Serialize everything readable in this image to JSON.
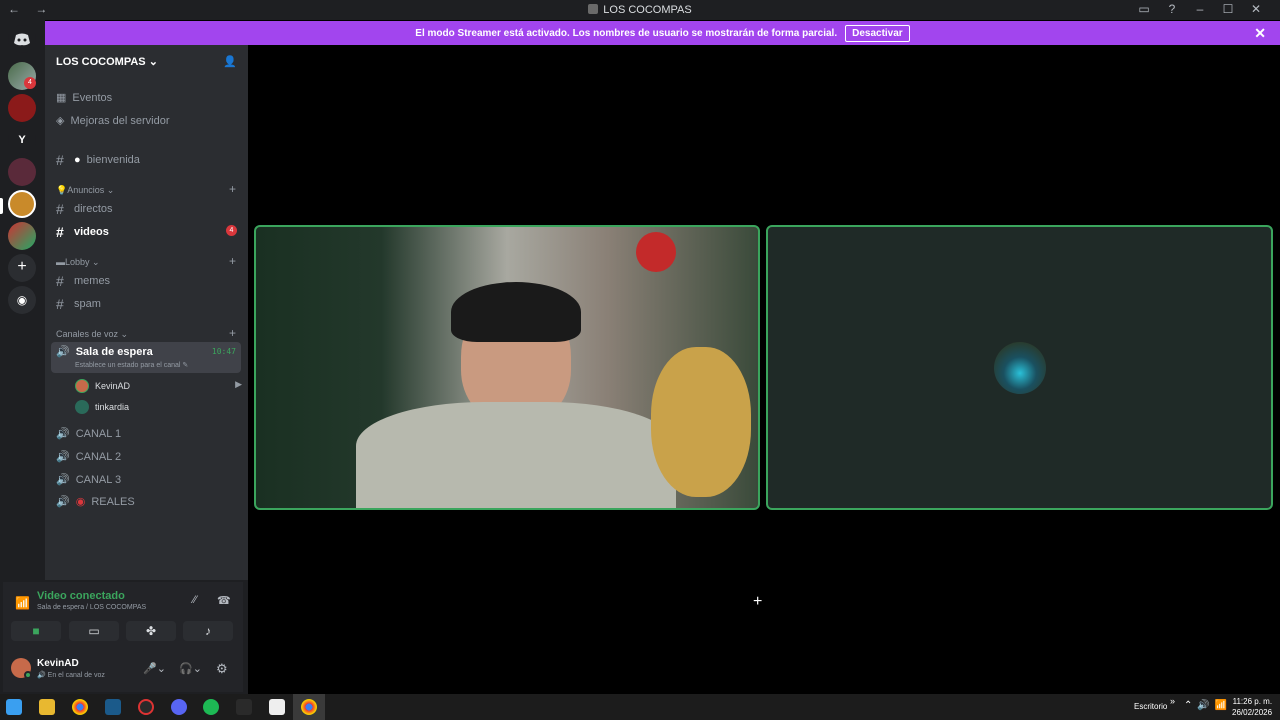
{
  "window": {
    "title": "LOS COCOMPAS"
  },
  "banner": {
    "text": "El modo Streamer está activado. Los nombres de usuario se mostrarán de forma parcial.",
    "button": "Desactivar"
  },
  "server": {
    "name": "LOS COCOMPAS"
  },
  "sidebar": {
    "events": "Eventos",
    "boosts": "Mejoras del servidor",
    "welcome": "bienvenida",
    "cat_announcements": "Anuncios",
    "ch_directos": "directos",
    "ch_videos": "videos",
    "videos_badge": "4",
    "cat_lobby": "Lobby",
    "ch_memes": "memes",
    "ch_spam": "spam",
    "cat_voice": "Canales de voz",
    "voice_room": "Sala de espera",
    "voice_room_time": "10:47",
    "voice_room_status": "Establece un estado para el canal",
    "user1": "KevinAD",
    "user2": "tinkardia",
    "canal1": "CANAL 1",
    "canal2": "CANAL 2",
    "canal3": "CANAL 3",
    "reales": "REALES"
  },
  "voice": {
    "status": "Video conectado",
    "location": "Sala de espera / LOS COCOMPAS"
  },
  "user": {
    "name": "KevinAD",
    "status": "En el canal de voz"
  },
  "rail": {
    "server_badge": "4",
    "letter_server": "Y"
  },
  "taskbar": {
    "desktop_label": "Escritorio",
    "time": "11:26 p. m.",
    "date": "26/02/2026"
  },
  "colors": {
    "accent": "#a245ee",
    "connected": "#3ba55d",
    "badge": "#da373c"
  }
}
